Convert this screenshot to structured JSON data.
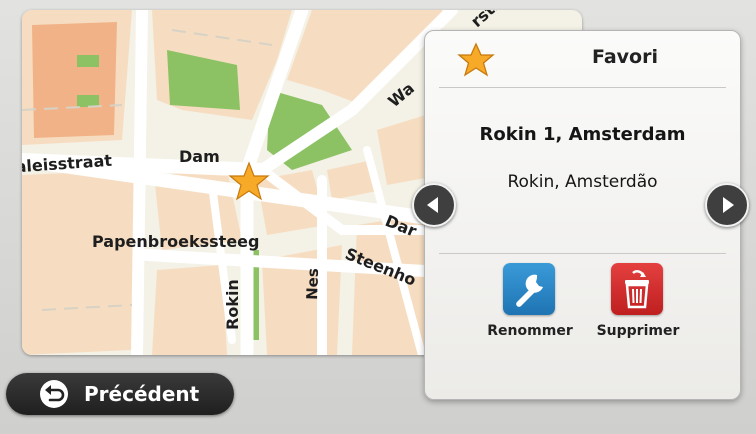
{
  "map": {
    "streets": [
      "Raadhuisstraat",
      "Dam",
      "Papenbroekssteeg",
      "Rokin",
      "Nes",
      "Steenhouwerssteeg",
      "Damstraat",
      "Warmoesstraat"
    ],
    "labels": {
      "raadhuisstraat": "aleisstraat",
      "dam": "Dam",
      "papenbroekssteeg": "Papenbroekssteeg",
      "rokin": "Rokin",
      "nes": "Nes",
      "steenhouwers": "Steenho",
      "damstraat": "Dar",
      "warmoes": "Wa",
      "top_street": "rstra"
    }
  },
  "panel": {
    "title": "Favori",
    "address_primary": "Rokin 1, Amsterdam",
    "address_secondary": "Rokin, Amsterdão",
    "rename_label": "Renommer",
    "delete_label": "Supprimer"
  },
  "back_button": {
    "label": "Précédent"
  },
  "colors": {
    "map_bg": "#f2efe4",
    "block": "#f6ddc1",
    "building": "#f1b287",
    "park": "#8dc264",
    "star": "#f7a928",
    "rename_blue": "#2386c6",
    "delete_red": "#d62b2b"
  }
}
